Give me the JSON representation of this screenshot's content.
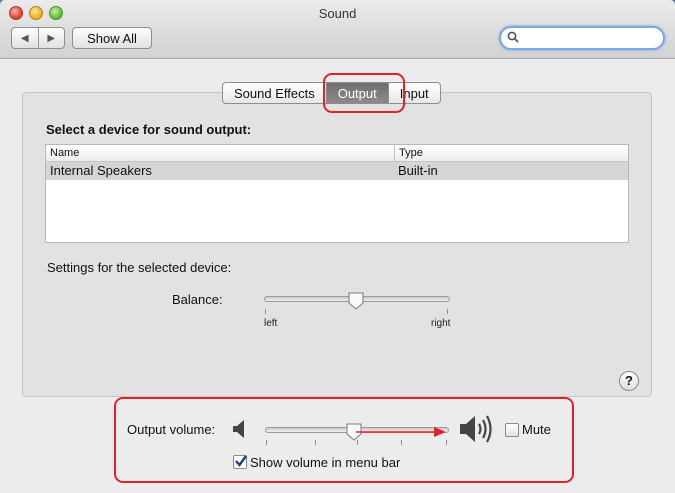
{
  "window": {
    "title": "Sound"
  },
  "toolbar": {
    "back_icon": "back-arrow",
    "forward_icon": "forward-arrow",
    "show_all_label": "Show All",
    "search_placeholder": ""
  },
  "tabs": [
    {
      "label": "Sound Effects",
      "active": false
    },
    {
      "label": "Output",
      "active": true
    },
    {
      "label": "Input",
      "active": false
    }
  ],
  "output": {
    "heading": "Select a device for sound output:",
    "columns": [
      "Name",
      "Type"
    ],
    "rows": [
      {
        "name": "Internal Speakers",
        "type": "Built-in",
        "selected": true
      }
    ],
    "settings_label": "Settings for the selected device:",
    "balance": {
      "label": "Balance:",
      "left_label": "left",
      "right_label": "right",
      "value": 0.5
    }
  },
  "volume": {
    "label": "Output volume:",
    "value": 0.49,
    "mute_label": "Mute",
    "muted": false,
    "show_in_menu_bar_label": "Show volume in menu bar",
    "show_in_menu_bar": true
  },
  "colors": {
    "highlight": "#e2222a",
    "selected_row": "#d5d5d5",
    "active_tab": "#7a7a7a"
  }
}
